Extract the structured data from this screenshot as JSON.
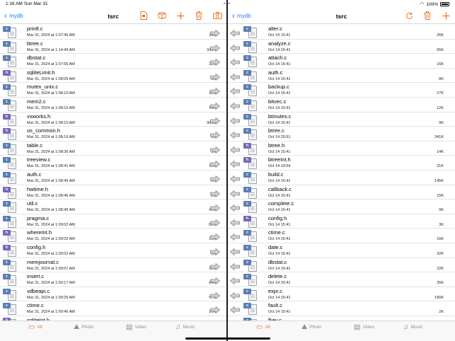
{
  "status": {
    "time": "1:16 AM",
    "date": "Sun Mar 31",
    "battery": "100%"
  },
  "left": {
    "back_label": "mydb",
    "title": "tsrc",
    "actions": [
      "file-copy-icon",
      "archive-box-icon",
      "plus-icon",
      "trash-icon",
      "camera-icon"
    ],
    "files": [
      {
        "name": "printf.c",
        "date": "Mar 31, 2024 at 1:07:45 AM",
        "size": "34K",
        "type": "c"
      },
      {
        "name": "btree.c",
        "date": "Mar 31, 2024 at 1:14:49 AM",
        "size": "341K",
        "type": "c"
      },
      {
        "name": "dbstat.c",
        "date": "Mar 31, 2024 at 1:07:55 AM",
        "size": "22K",
        "type": "c"
      },
      {
        "name": "sqliteLimit.h",
        "date": "Mar 31, 2024 at 1:08:05 AM",
        "size": "6K",
        "type": "h"
      },
      {
        "name": "mutex_unix.c",
        "date": "Mar 31, 2024 at 1:08:10 AM",
        "size": "12K",
        "type": "c"
      },
      {
        "name": "mem2.c",
        "date": "Mar 31, 2024 at 1:08:10 AM",
        "size": "14K",
        "type": "c"
      },
      {
        "name": "vxworks.h",
        "date": "Mar 31, 2024 at 1:08:10 AM",
        "size": "965B",
        "type": "h"
      },
      {
        "name": "os_common.h",
        "date": "Mar 31, 2024 at 1:08:16 AM",
        "size": "3K",
        "type": "h"
      },
      {
        "name": "table.c",
        "date": "Mar 31, 2024 at 1:08:36 AM",
        "size": "5K",
        "type": "c"
      },
      {
        "name": "treeview.c",
        "date": "Mar 31, 2024 at 1:08:41 AM",
        "size": "15K",
        "type": "c"
      },
      {
        "name": "auth.c",
        "date": "Mar 31, 2024 at 1:08:46 AM",
        "size": "8K",
        "type": "c"
      },
      {
        "name": "hwtime.h",
        "date": "Mar 31, 2024 at 1:08:46 AM",
        "size": "2K",
        "type": "h"
      },
      {
        "name": "util.c",
        "date": "Mar 31, 2024 at 1:08:46 AM",
        "size": "41K",
        "type": "c"
      },
      {
        "name": "pragma.c",
        "date": "Mar 31, 2024 at 1:09:02 AM",
        "size": "82K",
        "type": "c"
      },
      {
        "name": "whereInt.h",
        "date": "Mar 31, 2024 at 1:09:02 AM",
        "size": "25K",
        "type": "h"
      },
      {
        "name": "config.h",
        "date": "Mar 31, 2024 at 1:09:02 AM",
        "size": "3K",
        "type": "h"
      },
      {
        "name": "memjournal.c",
        "date": "Mar 31, 2024 at 1:09:07 AM",
        "size": "12K",
        "type": "c"
      },
      {
        "name": "insert.c",
        "date": "Mar 31, 2024 at 1:09:17 AM",
        "size": "84K",
        "type": "c"
      },
      {
        "name": "vdbeapi.c",
        "date": "Mar 31, 2024 at 1:09:25 AM",
        "size": "57K",
        "type": "c"
      },
      {
        "name": "ctime.c",
        "date": "Mar 31, 2024 at 1:09:46 AM",
        "size": "16K",
        "type": "c"
      },
      {
        "name": "sqliteInt.h",
        "date": "",
        "size": "",
        "type": "h"
      }
    ]
  },
  "right": {
    "back_label": "mydb",
    "title": "tsrc",
    "actions": [
      "refresh-icon",
      "trash-icon",
      "plus-icon"
    ],
    "files": [
      {
        "name": "alter.c",
        "date": "Oct 14 15:41",
        "size": "26K",
        "type": "c"
      },
      {
        "name": "analyze.c",
        "date": "Oct 14 15:41",
        "size": "65K",
        "type": "c"
      },
      {
        "name": "attach.c",
        "date": "Oct 14 15:41",
        "size": "16K",
        "type": "c"
      },
      {
        "name": "auth.c",
        "date": "Oct 14 15:41",
        "size": "8K",
        "type": "c"
      },
      {
        "name": "backup.c",
        "date": "Oct 14 15:41",
        "size": "27K",
        "type": "c"
      },
      {
        "name": "bitvec.c",
        "date": "Oct 14 15:41",
        "size": "12K",
        "type": "c"
      },
      {
        "name": "btmutex.c",
        "date": "Oct 14 15:41",
        "size": "9K",
        "type": "c"
      },
      {
        "name": "btree.c",
        "date": "Oct 14 20:51",
        "size": "341K",
        "type": "c"
      },
      {
        "name": "btree.h",
        "date": "Oct 14 15:41",
        "size": "14K",
        "type": "h"
      },
      {
        "name": "btreeInt.h",
        "date": "Oct 14 19:54",
        "size": "31K",
        "type": "h"
      },
      {
        "name": "build.c",
        "date": "Oct 14 15:41",
        "size": "145K",
        "type": "c"
      },
      {
        "name": "callback.c",
        "date": "Oct 14 15:41",
        "size": "15K",
        "type": "c"
      },
      {
        "name": "complete.c",
        "date": "Oct 14 15:41",
        "size": "9K",
        "type": "c"
      },
      {
        "name": "config.h",
        "date": "Oct 14 15:41",
        "size": "3K",
        "type": "h"
      },
      {
        "name": "ctime.c",
        "date": "Oct 14 15:41",
        "size": "16K",
        "type": "c"
      },
      {
        "name": "date.c",
        "date": "Oct 14 15:41",
        "size": "32K",
        "type": "c"
      },
      {
        "name": "dbstat.c",
        "date": "Oct 14 15:41",
        "size": "22K",
        "type": "c"
      },
      {
        "name": "delete.c",
        "date": "Oct 14 15:41",
        "size": "35K",
        "type": "c"
      },
      {
        "name": "expr.c",
        "date": "Oct 14 15:41",
        "size": "180K",
        "type": "c"
      },
      {
        "name": "fault.c",
        "date": "Oct 14 15:41",
        "size": "2K",
        "type": "c"
      },
      {
        "name": "fkey.c",
        "date": "",
        "size": "",
        "type": "c"
      }
    ]
  },
  "tabs": [
    {
      "label": "All",
      "icon": "folder-icon",
      "active": true
    },
    {
      "label": "Photo",
      "icon": "photo-icon",
      "active": false
    },
    {
      "label": "Video",
      "icon": "film-icon",
      "active": false
    },
    {
      "label": "Music",
      "icon": "music-note-icon",
      "active": false
    }
  ],
  "colors": {
    "accent": "#e8732a",
    "link": "#1e7cf0",
    "c_badge": "#5a7fb2",
    "h_badge": "#7669b8"
  }
}
